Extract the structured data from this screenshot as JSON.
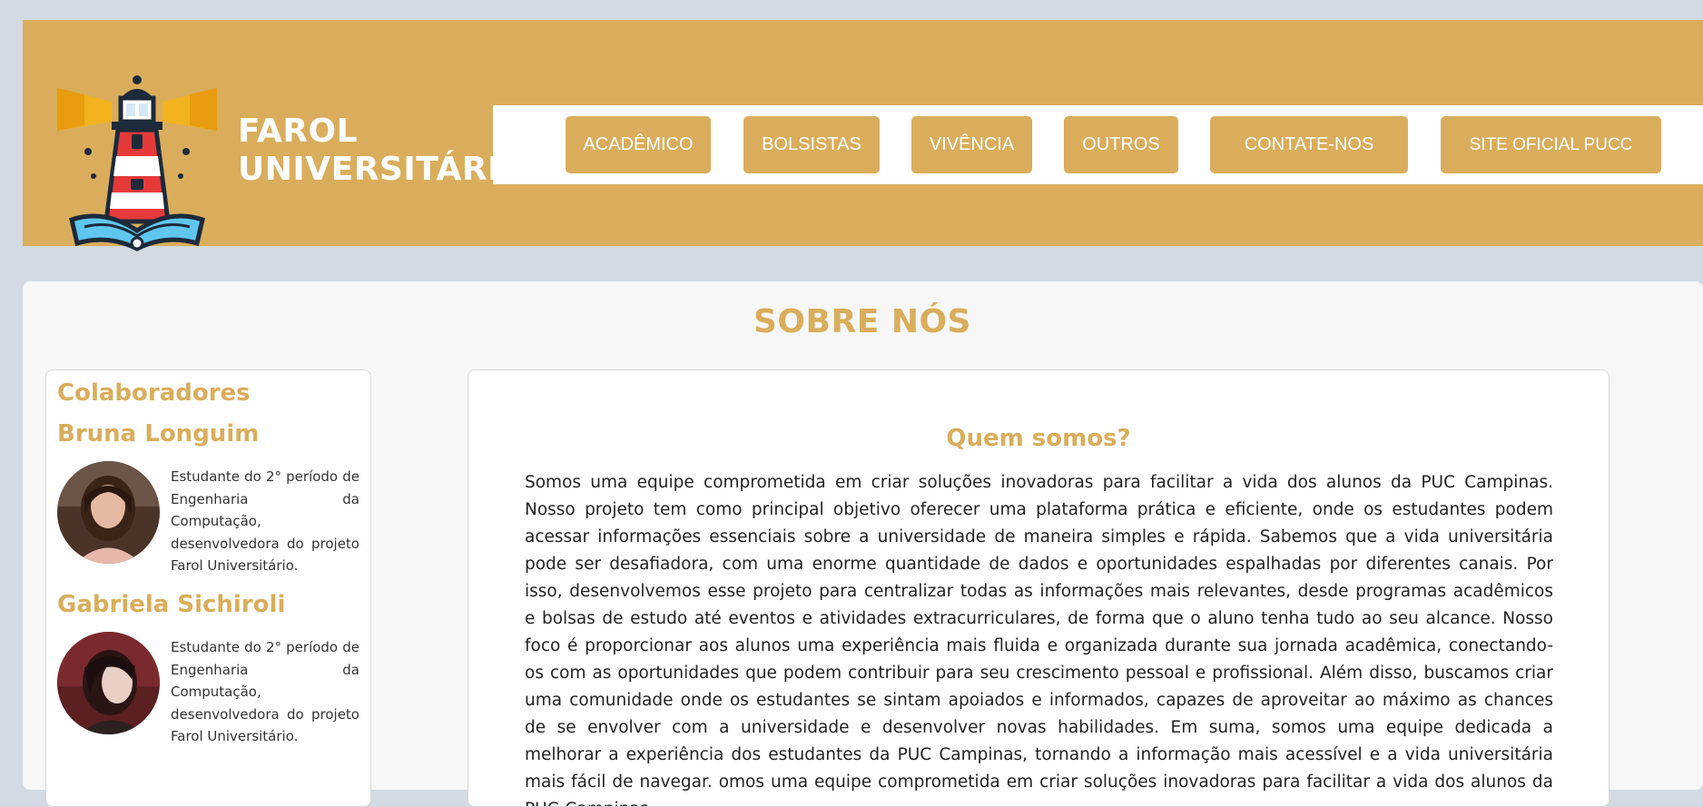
{
  "brand": {
    "line1": "FAROL",
    "line2": "UNIVERSITÁRIO"
  },
  "nav": {
    "items": [
      {
        "label": "ACADÊMICO"
      },
      {
        "label": "BOLSISTAS"
      },
      {
        "label": "VIVÊNCIA"
      },
      {
        "label": "OUTROS"
      },
      {
        "label": "CONTATE-NOS"
      },
      {
        "label": "SITE OFICIAL PUCC"
      }
    ]
  },
  "page": {
    "title": "SOBRE NÓS"
  },
  "sidebar": {
    "title": "Colaboradores",
    "collaborators": [
      {
        "name": "Bruna Longuim",
        "description": "Estudante do 2° período de Engenharia da Computação, desenvolvedora do projeto Farol Universitário."
      },
      {
        "name": "Gabriela Sichiroli",
        "description": "Estudante do 2° período de Engenharia da Computação, desenvolvedora do projeto Farol Universitário."
      }
    ]
  },
  "main": {
    "section_title": "Quem somos?",
    "text": "Somos uma equipe comprometida em criar soluções inovadoras para facilitar a vida dos alunos da PUC Campinas. Nosso projeto tem como principal objetivo oferecer uma plataforma prática e eficiente, onde os estudantes podem acessar informações essenciais sobre a universidade de maneira simples e rápida. Sabemos que a vida universitária pode ser desafiadora, com uma enorme quantidade de dados e oportunidades espalhadas por diferentes canais. Por isso, desenvolvemos esse projeto para centralizar todas as informações mais relevantes, desde programas acadêmicos e bolsas de estudo até eventos e atividades extracurriculares, de forma que o aluno tenha tudo ao seu alcance. Nosso foco é proporcionar aos alunos uma experiência mais fluida e organizada durante sua jornada acadêmica, conectando-os com as oportunidades que podem contribuir para seu crescimento pessoal e profissional. Além disso, buscamos criar uma comunidade onde os estudantes se sintam apoiados e informados, capazes de aproveitar ao máximo as chances de se envolver com a universidade e desenvolver novas habilidades. Em suma, somos uma equipe dedicada a melhorar a experiência dos estudantes da PUC Campinas, tornando a informação mais acessível e a vida universitária mais fácil de navegar. omos uma equipe comprometida em criar soluções inovadoras para facilitar a vida dos alunos da PUC Campinas."
  },
  "colors": {
    "accent": "#d9ad5b",
    "background": "#d3dae3",
    "panel": "#f7f7f7"
  },
  "icons": {
    "logo": "lighthouse-book-icon"
  }
}
